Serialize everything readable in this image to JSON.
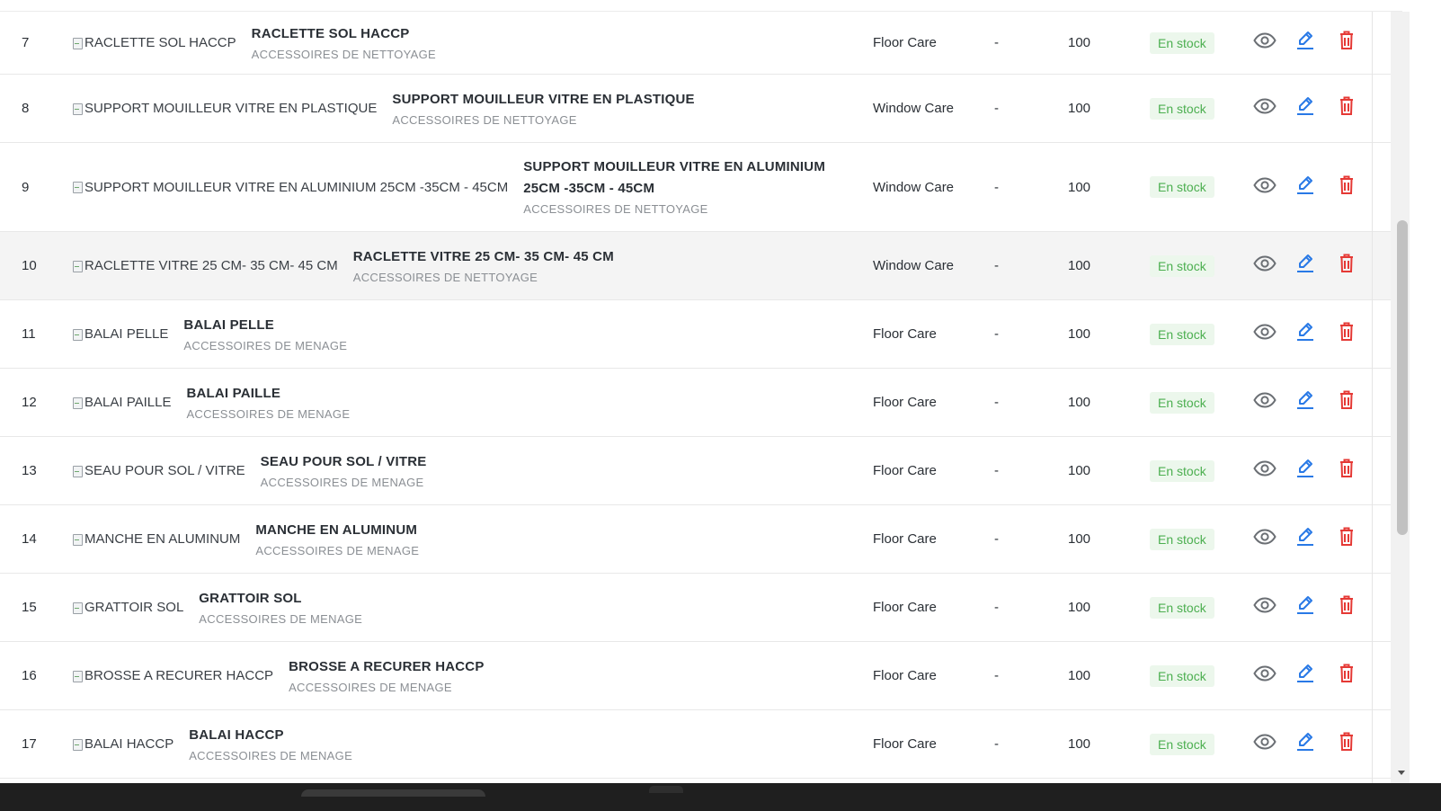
{
  "colors": {
    "badge_bg": "#ecf7ec",
    "badge_text": "#4caf50",
    "edit_icon": "#2979e6",
    "delete_icon": "#e53935",
    "view_icon": "#6b6f74"
  },
  "icons": {
    "view": "eye-icon",
    "edit": "pencil-icon",
    "delete": "trash-icon"
  },
  "rows": [
    {
      "id": "7",
      "img_alt": "RACLETTE SOL HACCP",
      "name": "RACLETTE SOL HACCP",
      "category": "ACCESSOIRES DE NETTOYAGE",
      "type": "Floor Care",
      "ref": "-",
      "qty": "100",
      "stock": "En stock"
    },
    {
      "id": "8",
      "img_alt": "SUPPORT MOUILLEUR VITRE EN PLASTIQUE",
      "name": "SUPPORT MOUILLEUR VITRE EN PLASTIQUE",
      "category": "ACCESSOIRES DE NETTOYAGE",
      "type": "Window Care",
      "ref": "-",
      "qty": "100",
      "stock": "En stock"
    },
    {
      "id": "9",
      "img_alt": "SUPPORT MOUILLEUR VITRE EN ALUMINIUM 25CM -35CM - 45CM",
      "name": "SUPPORT MOUILLEUR VITRE EN ALUMINIUM",
      "name2": "25CM -35CM - 45CM",
      "category": "ACCESSOIRES DE NETTOYAGE",
      "type": "Window Care",
      "ref": "-",
      "qty": "100",
      "stock": "En stock"
    },
    {
      "id": "10",
      "img_alt": "RACLETTE VITRE 25 CM- 35 CM- 45 CM",
      "name": "RACLETTE VITRE 25 CM- 35 CM- 45 CM",
      "category": "ACCESSOIRES DE NETTOYAGE",
      "type": "Window Care",
      "ref": "-",
      "qty": "100",
      "stock": "En stock"
    },
    {
      "id": "11",
      "img_alt": "BALAI PELLE",
      "name": "BALAI PELLE",
      "category": "ACCESSOIRES DE MENAGE",
      "type": "Floor Care",
      "ref": "-",
      "qty": "100",
      "stock": "En stock"
    },
    {
      "id": "12",
      "img_alt": "BALAI PAILLE",
      "name": "BALAI PAILLE",
      "category": "ACCESSOIRES DE MENAGE",
      "type": "Floor Care",
      "ref": "-",
      "qty": "100",
      "stock": "En stock"
    },
    {
      "id": "13",
      "img_alt": "SEAU POUR SOL / VITRE",
      "name": "SEAU POUR SOL / VITRE",
      "category": "ACCESSOIRES DE MENAGE",
      "type": "Floor Care",
      "ref": "-",
      "qty": "100",
      "stock": "En stock"
    },
    {
      "id": "14",
      "img_alt": "MANCHE EN ALUMINUM",
      "name": "MANCHE EN ALUMINUM",
      "category": "ACCESSOIRES DE MENAGE",
      "type": "Floor Care",
      "ref": "-",
      "qty": "100",
      "stock": "En stock"
    },
    {
      "id": "15",
      "img_alt": "GRATTOIR SOL",
      "name": "GRATTOIR SOL",
      "category": "ACCESSOIRES DE MENAGE",
      "type": "Floor Care",
      "ref": "-",
      "qty": "100",
      "stock": "En stock"
    },
    {
      "id": "16",
      "img_alt": "BROSSE A RECURER HACCP",
      "name": "BROSSE A RECURER HACCP",
      "category": "ACCESSOIRES DE MENAGE",
      "type": "Floor Care",
      "ref": "-",
      "qty": "100",
      "stock": "En stock"
    },
    {
      "id": "17",
      "img_alt": "BALAI HACCP",
      "name": "BALAI HACCP",
      "category": "ACCESSOIRES DE MENAGE",
      "type": "Floor Care",
      "ref": "-",
      "qty": "100",
      "stock": "En stock"
    }
  ]
}
